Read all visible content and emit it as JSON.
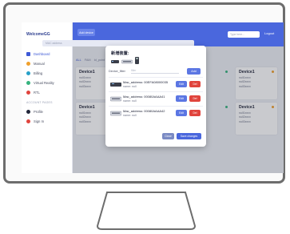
{
  "app": {
    "brand": "WelcomeGG",
    "top_button": "Add device",
    "search_placeholder": "Type here...",
    "logout": "Logout",
    "filter_placeholder": "MAC address"
  },
  "sidebar": {
    "items": [
      {
        "label": "Dashboard",
        "icon": "dashboard-icon",
        "color": "#3d59d6",
        "active": true
      },
      {
        "label": "Manual",
        "icon": "manual-icon",
        "color": "#f0a02c"
      },
      {
        "label": "Billing",
        "icon": "billing-icon",
        "color": "#27a0c8"
      },
      {
        "label": "Virtual Reality",
        "icon": "vr-icon",
        "color": "#36b37e"
      },
      {
        "label": "RTL",
        "icon": "rtl-icon",
        "color": "#e0443d"
      }
    ],
    "section": "ACCOUNT PAGES",
    "account_items": [
      {
        "label": "Profile",
        "icon": "profile-icon",
        "color": "#22263a"
      },
      {
        "label": "Sign In",
        "icon": "signin-icon",
        "color": "#e0443d"
      }
    ]
  },
  "breadcrumb": [
    "ALL",
    "FAM",
    "Id_point"
  ],
  "cards_left": [
    {
      "title": "Device1",
      "lines": [
        "null1xxxx",
        "null2xxxx",
        "null3xxxx"
      ]
    },
    {
      "title": "Device1",
      "lines": [
        "null1xxxx",
        "null2xxxx",
        "null3xxxx"
      ]
    }
  ],
  "cards_right": [
    {
      "title": "Device1",
      "lines": [
        "null1xxxx",
        "null2xxxx",
        "null3xxxx"
      ],
      "dot": "#f0a02c"
    },
    {
      "title": "Device1",
      "lines": [
        "null1xxxx",
        "null2xxxx",
        "null3xxxx"
      ],
      "dot": "#f0a02c"
    }
  ],
  "right_dots": [
    "#36b37e",
    "#36b37e"
  ],
  "modal": {
    "title": "新增装置:",
    "device_types": [
      {
        "label": "",
        "icon": "router-icon"
      },
      {
        "label": "",
        "icon": "switch-icon"
      },
      {
        "label": "",
        "icon": "gateway-icon"
      }
    ],
    "filter_label": "Device_filter",
    "filter_placeholder": "filter",
    "add_label": "Add",
    "rows": [
      {
        "mac": "Mac_address: 00EFA08000035",
        "name": "name: null",
        "icon": "router-icon"
      },
      {
        "mac": "Mac_address: 00080AAAA41",
        "name": "name: null",
        "icon": "switch-icon"
      },
      {
        "mac": "Mac_address: 00080AAAA42",
        "name": "name: null",
        "icon": "switch-icon"
      }
    ],
    "edit_label": "Edit",
    "delete_label": "Del",
    "close_label": "Close",
    "save_label": "Save changes"
  },
  "colors": {
    "primary": "#4a67dd",
    "danger": "#e0443d",
    "frame": "#6d6d6d"
  }
}
